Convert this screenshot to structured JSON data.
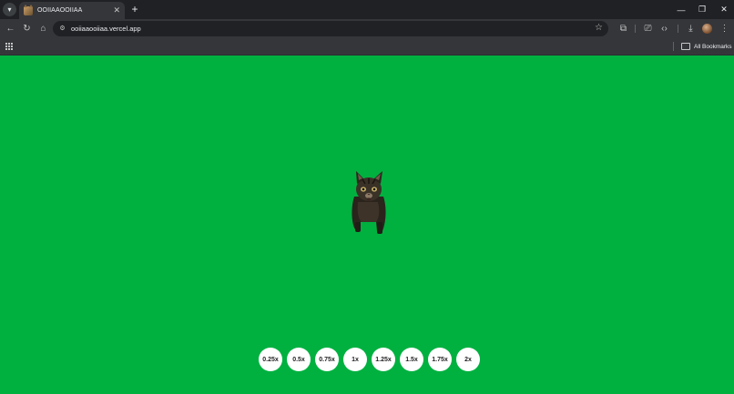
{
  "browser": {
    "tab": {
      "title": "OOIIAAOOIIAA",
      "favicon": "cat-face-icon"
    },
    "address_bar": {
      "url": "ooiiaaooiiaa.vercel.app"
    },
    "bookmarks_bar": {
      "all_bookmarks_label": "All Bookmarks"
    },
    "toolbar_glyphs": {
      "tab_menu": "▾",
      "close": "✕",
      "new_tab": "+",
      "minimize": "—",
      "restore": "❐",
      "win_close": "✕",
      "back": "←",
      "reload": "↻",
      "home": "⌂",
      "site_info": "⚙",
      "star": "☆",
      "extensions": "⧉",
      "cast": "⎚",
      "devtools": "‹›",
      "download": "⤓",
      "more": "⋮"
    }
  },
  "page": {
    "background_color": "#00b140",
    "image": "spinning-cat",
    "speed_buttons": [
      "0.25x",
      "0.5x",
      "0.75x",
      "1x",
      "1.25x",
      "1.5x",
      "1.75x",
      "2x"
    ]
  }
}
